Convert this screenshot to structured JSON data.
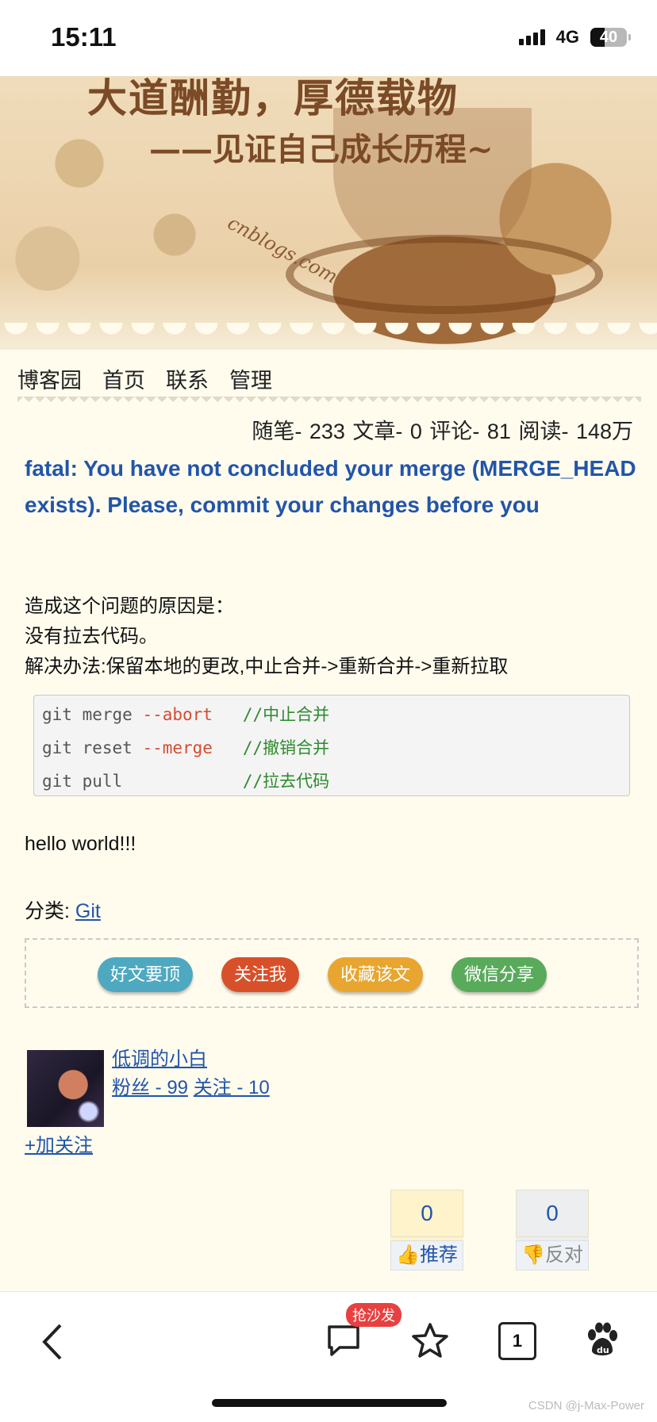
{
  "status_bar": {
    "time": "15:11",
    "network": "4G",
    "battery": "40",
    "battery_level": 0.4
  },
  "banner": {
    "line1": "大道酬勤，厚德载物",
    "line2": "——见证自己成长历程~",
    "watermark": "cnblogs.com"
  },
  "nav": [
    "博客园",
    "首页",
    "联系",
    "管理"
  ],
  "stats": "随笔- 233  文章- 0  评论- 81  阅读- 148万",
  "post": {
    "title": "fatal: You have not concluded your merge (MERGE_HEAD exists). Please, commit your changes before you",
    "p1": "造成这个问题的原因是：",
    "p2": "没有拉去代码。",
    "p3": "解决办法:保留本地的更改,中止合并->重新合并->重新拉取",
    "code": [
      {
        "cmd": "git merge ",
        "flag": "--abort",
        "pad": "   ",
        "comment": "//中止合并"
      },
      {
        "cmd": "git reset ",
        "flag": "--merge",
        "pad": "   ",
        "comment": "//撤销合并"
      },
      {
        "cmd": "git pull",
        "flag": "",
        "pad": "            ",
        "comment": "//拉去代码"
      }
    ],
    "hello": "hello world!!!",
    "category_label": "分类: ",
    "category": "Git"
  },
  "share_buttons": [
    {
      "label": "好文要顶",
      "color": "#4ea8c0"
    },
    {
      "label": "关注我",
      "color": "#d8502a"
    },
    {
      "label": "收藏该文",
      "color": "#e8a630"
    },
    {
      "label": "微信分享",
      "color": "#5aaa5c"
    }
  ],
  "author": {
    "name": "低调的小白",
    "fans": "粉丝 - 99",
    "follow": "关注 - 10",
    "add_follow": "+加关注"
  },
  "votes": {
    "digg_count": "0",
    "digg_label": "推荐",
    "bury_count": "0",
    "bury_label": "反对"
  },
  "bottom_bar": {
    "badge": "抢沙发",
    "tab_count": "1",
    "watermark": "CSDN @j-Max-Power"
  }
}
